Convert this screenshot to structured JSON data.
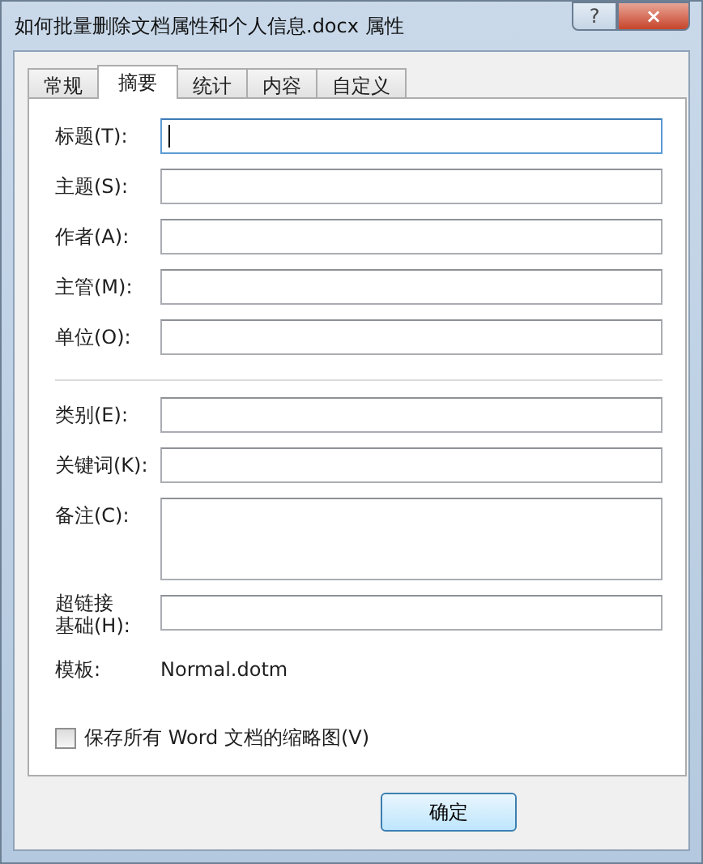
{
  "window": {
    "title": "如何批量删除文档属性和个人信息.docx 属性",
    "help": "?",
    "close": "×"
  },
  "tabs": [
    {
      "label": "常规",
      "selected": false
    },
    {
      "label": "摘要",
      "selected": true
    },
    {
      "label": "统计",
      "selected": false
    },
    {
      "label": "内容",
      "selected": false
    },
    {
      "label": "自定义",
      "selected": false
    }
  ],
  "fields_group_1": [
    {
      "label": "标题(T):",
      "kind": "input",
      "focused": true
    },
    {
      "label": "主题(S):",
      "kind": "input",
      "focused": false
    },
    {
      "label": "作者(A):",
      "kind": "input",
      "focused": false
    },
    {
      "label": "主管(M):",
      "kind": "input",
      "focused": false
    },
    {
      "label": "单位(O):",
      "kind": "input",
      "focused": false
    }
  ],
  "fields_group_2": [
    {
      "label": "类别(E):",
      "kind": "input",
      "focused": false
    },
    {
      "label": "关键词(K):",
      "kind": "input",
      "focused": false
    },
    {
      "label": "备注(C):",
      "kind": "textarea",
      "focused": false
    },
    {
      "label_lines": [
        "超链接",
        "基础(H):"
      ],
      "kind": "input",
      "focused": false
    },
    {
      "label": "模板:",
      "kind": "text",
      "value": "Normal.dotm"
    }
  ],
  "thumbnail_checkbox": {
    "label": "保存所有 Word 文档的缩略图(V)",
    "checked": false
  },
  "buttons": [
    "确定"
  ]
}
